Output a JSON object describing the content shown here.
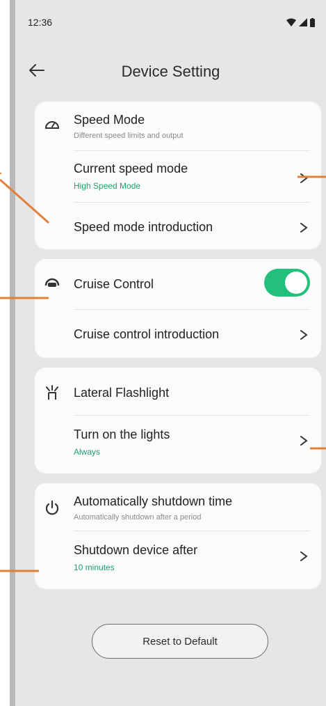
{
  "status_bar": {
    "time": "12:36",
    "icons": [
      "wifi-icon",
      "signal-icon",
      "battery-icon"
    ]
  },
  "header": {
    "title": "Device Setting",
    "back_icon": "back-arrow-icon"
  },
  "speed_mode": {
    "icon": "speedometer-icon",
    "title": "Speed Mode",
    "subtitle": "Different speed limits and output",
    "current": {
      "label": "Current speed mode",
      "value": "High Speed Mode"
    },
    "intro_label": "Speed mode introduction"
  },
  "cruise": {
    "icon": "cruise-control-icon",
    "title": "Cruise Control",
    "enabled": true,
    "intro_label": "Cruise control introduction"
  },
  "flashlight": {
    "icon": "light-icon",
    "title": "Lateral Flashlight",
    "lights": {
      "label": "Turn on the lights",
      "value": "Always"
    }
  },
  "shutdown": {
    "icon": "power-icon",
    "title": "Automatically shutdown time",
    "subtitle": "Automatically shutdown after a period",
    "after": {
      "label": "Shutdown device after",
      "value": "10 minutes"
    }
  },
  "reset_label": "Reset to Default",
  "colors": {
    "accent_green": "#1aa36b",
    "toggle_green": "#22c07a",
    "annotation_orange": "#e0803a"
  }
}
